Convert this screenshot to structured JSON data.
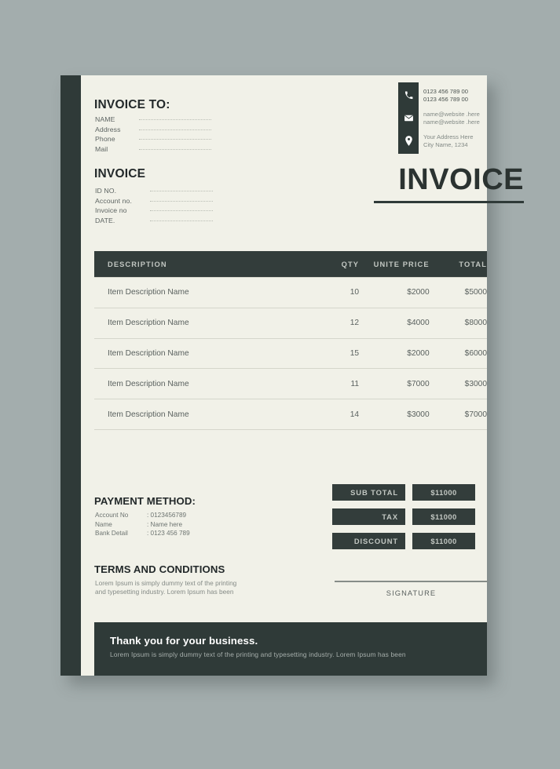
{
  "document": {
    "type": "invoice-template",
    "colors": {
      "page_background": "#f1f1e8",
      "canvas_background": "#a3adad",
      "dark": "#2f3a38",
      "table_header": "#333d3b",
      "muted_text": "#858b87"
    }
  },
  "bill_to": {
    "title": "INVOICE TO:",
    "fields": [
      {
        "label": "NAME"
      },
      {
        "label": "Address"
      },
      {
        "label": "Phone"
      },
      {
        "label": "Mail"
      }
    ]
  },
  "invoice_meta": {
    "title": "INVOICE",
    "fields": [
      {
        "label": "ID NO."
      },
      {
        "label": "Account no."
      },
      {
        "label": "Invoice no"
      },
      {
        "label": "DATE."
      }
    ]
  },
  "contact": {
    "groups": [
      {
        "icon": "phone-icon",
        "lines": [
          "0123 456 789 00",
          "0123 456 789 00"
        ],
        "tone": "dark"
      },
      {
        "icon": "envelope-icon",
        "lines": [
          "name@website .here",
          "name@website .here"
        ],
        "tone": "muted"
      },
      {
        "icon": "location-pin-icon",
        "lines": [
          "Your Address Here",
          "City Name, 1234"
        ],
        "tone": "muted"
      }
    ]
  },
  "wordmark": {
    "text": "INVOICE"
  },
  "table": {
    "headers": {
      "description": "DESCRIPTION",
      "qty": "QTY",
      "unit_price": "UNITE PRICE",
      "total": "TOTAL"
    },
    "rows": [
      {
        "description": "Item Description Name",
        "qty": "10",
        "unit_price": "$2000",
        "total": "$5000"
      },
      {
        "description": "Item Description Name",
        "qty": "12",
        "unit_price": "$4000",
        "total": "$8000"
      },
      {
        "description": "Item Description Name",
        "qty": "15",
        "unit_price": "$2000",
        "total": "$6000"
      },
      {
        "description": "Item Description Name",
        "qty": "11",
        "unit_price": "$7000",
        "total": "$3000"
      },
      {
        "description": "Item Description Name",
        "qty": "14",
        "unit_price": "$3000",
        "total": "$7000"
      }
    ]
  },
  "payment_method": {
    "title": "PAYMENT METHOD:",
    "rows": [
      {
        "key": "Account No",
        "value": ": 0123456789"
      },
      {
        "key": "Name",
        "value": ": Name here"
      },
      {
        "key": "Bank Detail",
        "value": ": 0123 456 789"
      }
    ]
  },
  "totals": {
    "rows": [
      {
        "label": "SUB TOTAL",
        "value": "$11000"
      },
      {
        "label": "TAX",
        "value": "$11000"
      },
      {
        "label": "DISCOUNT",
        "value": "$11000"
      }
    ]
  },
  "terms": {
    "title": "TERMS AND CONDITIONS",
    "body": "Lorem Ipsum is simply dummy text of the printing and typesetting industry. Lorem Ipsum has been"
  },
  "signature": {
    "label": "SIGNATURE"
  },
  "footer": {
    "title": "Thank you for your business.",
    "subtitle": "Lorem Ipsum is simply dummy text of the printing and typesetting industry. Lorem Ipsum has been"
  }
}
